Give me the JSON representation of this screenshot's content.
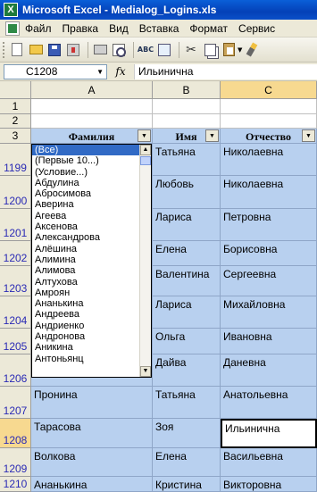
{
  "window": {
    "title": "Microsoft Excel - Medialog_Logins.xls",
    "app_icon_letter": "X"
  },
  "menu": {
    "items": [
      "Файл",
      "Правка",
      "Вид",
      "Вставка",
      "Формат",
      "Сервис"
    ]
  },
  "toolbar": {
    "buttons": [
      "new-icon",
      "open-icon",
      "save-icon",
      "permission-icon",
      "print-icon",
      "print-preview-icon",
      "spelling-icon",
      "research-icon",
      "cut-icon",
      "copy-icon",
      "paste-icon",
      "format-painter-icon"
    ],
    "spelling_label": "ABC"
  },
  "formula_bar": {
    "name_box": "C1208",
    "fx_label": "fx",
    "formula": "Ильинична",
    "dropdown_arrow": "▼"
  },
  "columns": [
    "A",
    "B",
    "C"
  ],
  "rows": {
    "r1": "1",
    "r2": "2",
    "r3": "3",
    "r1199": "1199",
    "r1200": "1200",
    "r1201": "1201",
    "r1202": "1202",
    "r1203": "1203",
    "r1204": "1204",
    "r1205": "1205",
    "r1206": "1206",
    "r1207": "1207",
    "r1208": "1208",
    "r1209": "1209",
    "r1210": "1210"
  },
  "headers": {
    "a": "Фамилия",
    "b": "Имя",
    "c": "Отчество",
    "filter_arrow": "▼"
  },
  "data": {
    "b1199": "Татьяна",
    "c1199": "Николаевна",
    "b1200": "Любовь",
    "c1200": "Николаевна",
    "b1201": "Лариса",
    "c1201": "Петровна",
    "b1202": "Елена",
    "c1202": "Борисовна",
    "b1203": "Валентина",
    "c1203": "Сергеевна",
    "b1204": "Лариса",
    "c1204": "Михайловна",
    "b1205": "Ольга",
    "c1205": "Ивановна",
    "b1206": "Дайва",
    "c1206": "Даневна",
    "a1207": "Пронина",
    "b1207": "Татьяна",
    "c1207": "Анатольевна",
    "a1208": "Тарасова",
    "b1208": "Зоя",
    "c1208": "Ильинична",
    "a1209": "Волкова",
    "b1209": "Елена",
    "c1209": "Васильевна",
    "a1210": "Ананькина",
    "b1210": "Кристина",
    "c1210": "Викторовна"
  },
  "autofilter_list": {
    "items": [
      "(Все)",
      "(Первые 10...)",
      "(Условие...)",
      "Абдулина",
      "Абросимова",
      "Аверина",
      "Агеева",
      "Аксенова",
      "Александрова",
      "Алёшина",
      "Алимина",
      "Алимова",
      "Алтухова",
      "Амроян",
      "Ананькина",
      "Андреева",
      "Андриенко",
      "Андронова",
      "Аникина",
      "Антоньянц"
    ],
    "selected_index": 0,
    "scroll_up": "▲",
    "scroll_down": "▼"
  },
  "colors": {
    "filter_blue": "#b8d0ef",
    "title_blue": "#0441b8",
    "selection": "#316ac5",
    "row_filtered": "#2b2bb5"
  }
}
